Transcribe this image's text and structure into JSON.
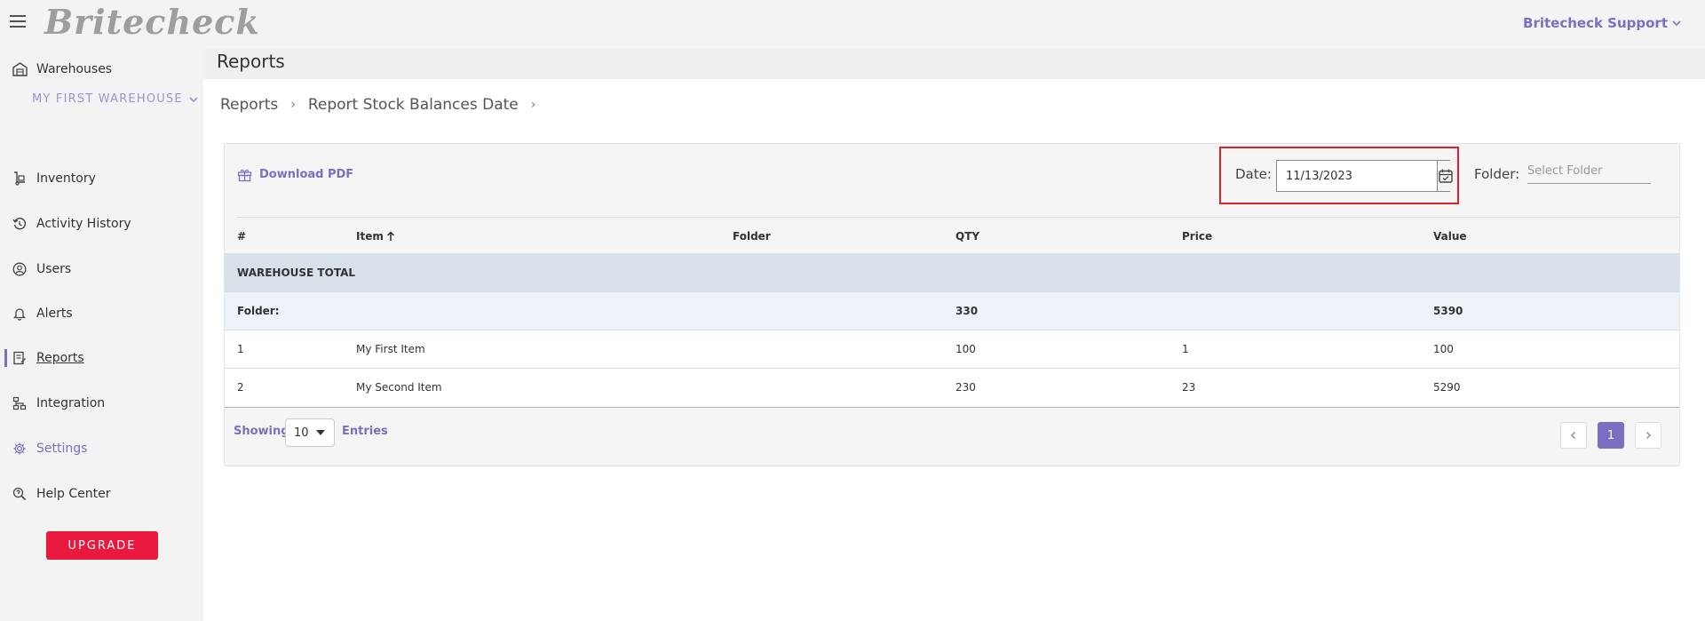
{
  "app": {
    "logo": "Britecheck",
    "user": "Britecheck Support"
  },
  "sidebar": {
    "warehouse_heading": "Warehouses",
    "selected_warehouse": "MY FIRST WAREHOUSE",
    "items": [
      {
        "label": "Inventory",
        "icon": "hand-truck-icon"
      },
      {
        "label": "Activity History",
        "icon": "history-icon"
      },
      {
        "label": "Users",
        "icon": "user-circle-icon"
      },
      {
        "label": "Alerts",
        "icon": "bell-icon"
      },
      {
        "label": "Reports",
        "icon": "report-icon"
      },
      {
        "label": "Integration",
        "icon": "network-icon"
      },
      {
        "label": "Settings",
        "icon": "gear-icon"
      },
      {
        "label": "Help Center",
        "icon": "help-search-icon"
      }
    ],
    "upgrade_label": "UPGRADE"
  },
  "page": {
    "title": "Reports",
    "breadcrumb": [
      "Reports",
      "Report Stock Balances Date"
    ]
  },
  "toolbar": {
    "download_label": "Download PDF",
    "date_label": "Date:",
    "date_value": "11/13/2023",
    "folder_label": "Folder:",
    "folder_placeholder": "Select Folder"
  },
  "table": {
    "columns": [
      "#",
      "Item",
      "Folder",
      "QTY",
      "Price",
      "Value"
    ],
    "warehouse_total_label": "WAREHOUSE TOTAL",
    "folder_row": {
      "label": "Folder:",
      "qty": "330",
      "value": "5390"
    },
    "rows": [
      {
        "num": "1",
        "item": "My First Item",
        "folder": "",
        "qty": "100",
        "price": "1",
        "value": "100"
      },
      {
        "num": "2",
        "item": "My Second Item",
        "folder": "",
        "qty": "230",
        "price": "23",
        "value": "5290"
      }
    ]
  },
  "pagination": {
    "showing_label": "Showing",
    "page_size": "10",
    "entries_label": "Entries",
    "current_page": "1"
  },
  "colors": {
    "accent": "#7c6fc2",
    "upgrade": "#e8183f",
    "highlight_border": "#e11f2a"
  }
}
